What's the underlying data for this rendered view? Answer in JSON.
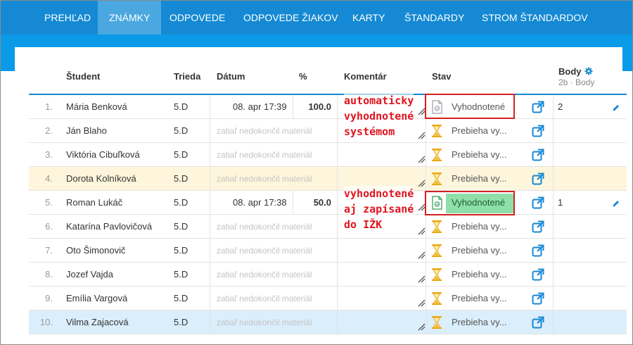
{
  "nav": {
    "items": [
      {
        "label": "PREHĽAD",
        "active": false
      },
      {
        "label": "ZNÁMKY",
        "active": true
      },
      {
        "label": "ODPOVEDE",
        "active": false
      },
      {
        "label": "ODPOVEDE ŽIAKOV",
        "active": false
      },
      {
        "label": "KARTY",
        "active": false
      },
      {
        "label": "ŠTANDARDY",
        "active": false
      },
      {
        "label": "STROM ŠTANDARDOV",
        "active": false
      }
    ]
  },
  "table": {
    "headers": {
      "student": "Študent",
      "class": "Trieda",
      "date": "Dátum",
      "percent": "%",
      "comment": "Komentár",
      "state": "Stav",
      "points": "Body",
      "points_sub": "2b · Body"
    },
    "rows": [
      {
        "index": "1.",
        "name": "Mária Benková",
        "class": "5.D",
        "date": "08. apr 17:39",
        "percent": "100.0",
        "status": "Vyhodnotené",
        "status_kind": "evaluated",
        "points": "2"
      },
      {
        "index": "2.",
        "name": "Ján Blaho",
        "class": "5.D",
        "date": "zatiaľ nedokončil materiál",
        "percent": "",
        "status": "Prebieha vy...",
        "status_kind": "pending",
        "points": ""
      },
      {
        "index": "3.",
        "name": "Viktória Cibuľková",
        "class": "5.D",
        "date": "zatiaľ nedokončil materiál",
        "percent": "",
        "status": "Prebieha vy...",
        "status_kind": "pending",
        "points": ""
      },
      {
        "index": "4.",
        "name": "Dorota Kolníková",
        "class": "5.D",
        "date": "zatiaľ nedokončil materiál",
        "percent": "",
        "status": "Prebieha vy...",
        "status_kind": "pending",
        "points": ""
      },
      {
        "index": "5.",
        "name": "Roman Lukáč",
        "class": "5.D",
        "date": "08. apr 17:38",
        "percent": "50.0",
        "status": "Vyhodnotené",
        "status_kind": "recorded",
        "points": "1"
      },
      {
        "index": "6.",
        "name": "Katarína Pavlovičová",
        "class": "5.D",
        "date": "zatiaľ nedokončil materiál",
        "percent": "",
        "status": "Prebieha vy...",
        "status_kind": "pending",
        "points": ""
      },
      {
        "index": "7.",
        "name": "Oto Šimonovič",
        "class": "5.D",
        "date": "zatiaľ nedokončil materiál",
        "percent": "",
        "status": "Prebieha vy...",
        "status_kind": "pending",
        "points": ""
      },
      {
        "index": "8.",
        "name": "Jozef Vajda",
        "class": "5.D",
        "date": "zatiaľ nedokončil materiál",
        "percent": "",
        "status": "Prebieha vy...",
        "status_kind": "pending",
        "points": ""
      },
      {
        "index": "9.",
        "name": "Emília Vargová",
        "class": "5.D",
        "date": "zatiaľ nedokončil materiál",
        "percent": "",
        "status": "Prebieha vy...",
        "status_kind": "pending",
        "points": ""
      },
      {
        "index": "10.",
        "name": "Vilma Zajacová",
        "class": "5.D",
        "date": "zatiaľ nedokončil materiál",
        "percent": "",
        "status": "Prebieha vy...",
        "status_kind": "pending",
        "points": ""
      }
    ]
  },
  "annotations": {
    "auto": [
      "automaticky",
      "vyhodnotené",
      "systémom"
    ],
    "recorded": [
      "vyhodnotené",
      "aj zapísané",
      "do IŽK"
    ]
  },
  "colors": {
    "nav_bg": "#1589d3",
    "nav_active": "#4aa7e0",
    "accent": "#1589d3",
    "annotation_red": "#e0141e",
    "recorded_green": "#8fdfa8",
    "highlight_yellow": "#fdf6dc",
    "highlight_blue": "#dbeefb"
  },
  "icons": {
    "evaluated": "document-check-icon",
    "pending": "hourglass-icon",
    "open": "external-link-icon",
    "edit": "pencil-icon",
    "settings": "gear-icon",
    "resize": "resize-handle-icon"
  }
}
